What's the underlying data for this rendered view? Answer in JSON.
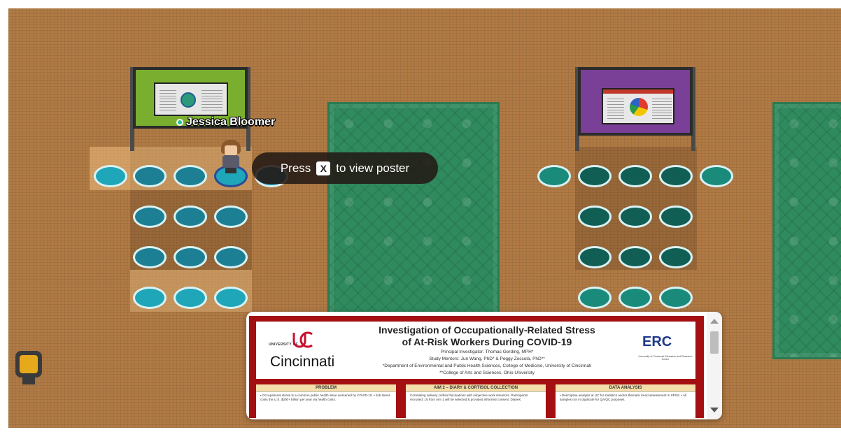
{
  "player": {
    "name": "Jessica Bloomer"
  },
  "prompt": {
    "press": "Press",
    "key": "X",
    "action": "to view poster"
  },
  "poster": {
    "university_top": "UNIVERSITY OF",
    "university_name": "Cincinnati",
    "title_line1": "Investigation of Occupationally-Related Stress",
    "title_line2": "of At-Risk Workers During COVID-19",
    "investigator": "Principal Investigator: Thomas Gerding, MPH*",
    "mentors": "Study Mentors: Jun Wang, PhD* & Peggy Zoccola, PhD**",
    "affiliation1": "*Department of Environmental and Public Health Sciences, College of Medicine, University of Cincinnati",
    "affiliation2": "**College of Arts and Sciences, Ohio University",
    "erc_logo": "ERC",
    "erc_sub": "University of Cincinnati Education and Research Center",
    "sections": [
      {
        "heading": "PROBLEM",
        "text": "• Occupational stress is a common public health issue worsened by COVID-19.  • Job stress costs the U.S. $300+ billion per year via health costs."
      },
      {
        "heading": "AIM 2 – DIARY & CORTISOL COLLECTION",
        "text": "Correlating salivary cortisol fluctuations with subjective work stressors. Participants recruited: 15 from Aim 1 will be selected & provided informed consent. Diaries:"
      },
      {
        "heading": "DATA ANALYSIS",
        "text": "• Descriptive analysis at UC for statistics and/or thematic trend assessment in SPSS.  • All samples run in duplicate for QA/QC purposes."
      }
    ]
  }
}
